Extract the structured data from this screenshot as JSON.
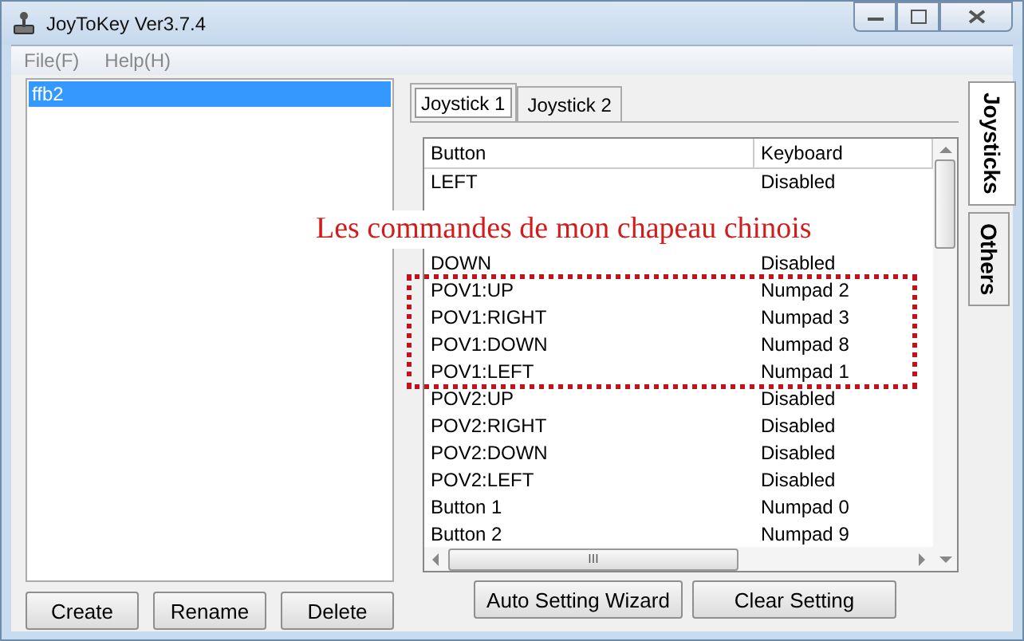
{
  "window": {
    "title": "JoyToKey Ver3.7.4"
  },
  "menu": [
    "File(F)",
    "Help(H)"
  ],
  "profiles": [
    {
      "label": "ffb2",
      "selected": true
    }
  ],
  "profile_buttons": [
    "Create",
    "Rename",
    "Delete"
  ],
  "tabs": [
    {
      "label": "Joystick 1",
      "selected": true
    },
    {
      "label": "Joystick 2",
      "selected": false
    }
  ],
  "side_tabs": [
    {
      "label": "Joysticks",
      "selected": true
    },
    {
      "label": "Others",
      "selected": false
    }
  ],
  "table": {
    "columns": [
      "Button",
      "Keyboard"
    ],
    "rows": [
      {
        "button": "LEFT",
        "keyboard": "Disabled"
      },
      {
        "button": "DOWN",
        "keyboard": "Disabled"
      },
      {
        "button": "POV1:UP",
        "keyboard": "Numpad 2"
      },
      {
        "button": "POV1:RIGHT",
        "keyboard": "Numpad 3"
      },
      {
        "button": "POV1:DOWN",
        "keyboard": "Numpad 8"
      },
      {
        "button": "POV1:LEFT",
        "keyboard": "Numpad 1"
      },
      {
        "button": "POV2:UP",
        "keyboard": "Disabled"
      },
      {
        "button": "POV2:RIGHT",
        "keyboard": "Disabled"
      },
      {
        "button": "POV2:DOWN",
        "keyboard": "Disabled"
      },
      {
        "button": "POV2:LEFT",
        "keyboard": "Disabled"
      },
      {
        "button": "Button 1",
        "keyboard": "Numpad 0"
      },
      {
        "button": "Button 2",
        "keyboard": "Numpad 9"
      }
    ],
    "scrollbar_grip": "III"
  },
  "action_buttons": [
    "Auto Setting Wizard",
    "Clear Setting"
  ],
  "annotation": {
    "text": "Les commandes de mon chapeau chinois"
  }
}
